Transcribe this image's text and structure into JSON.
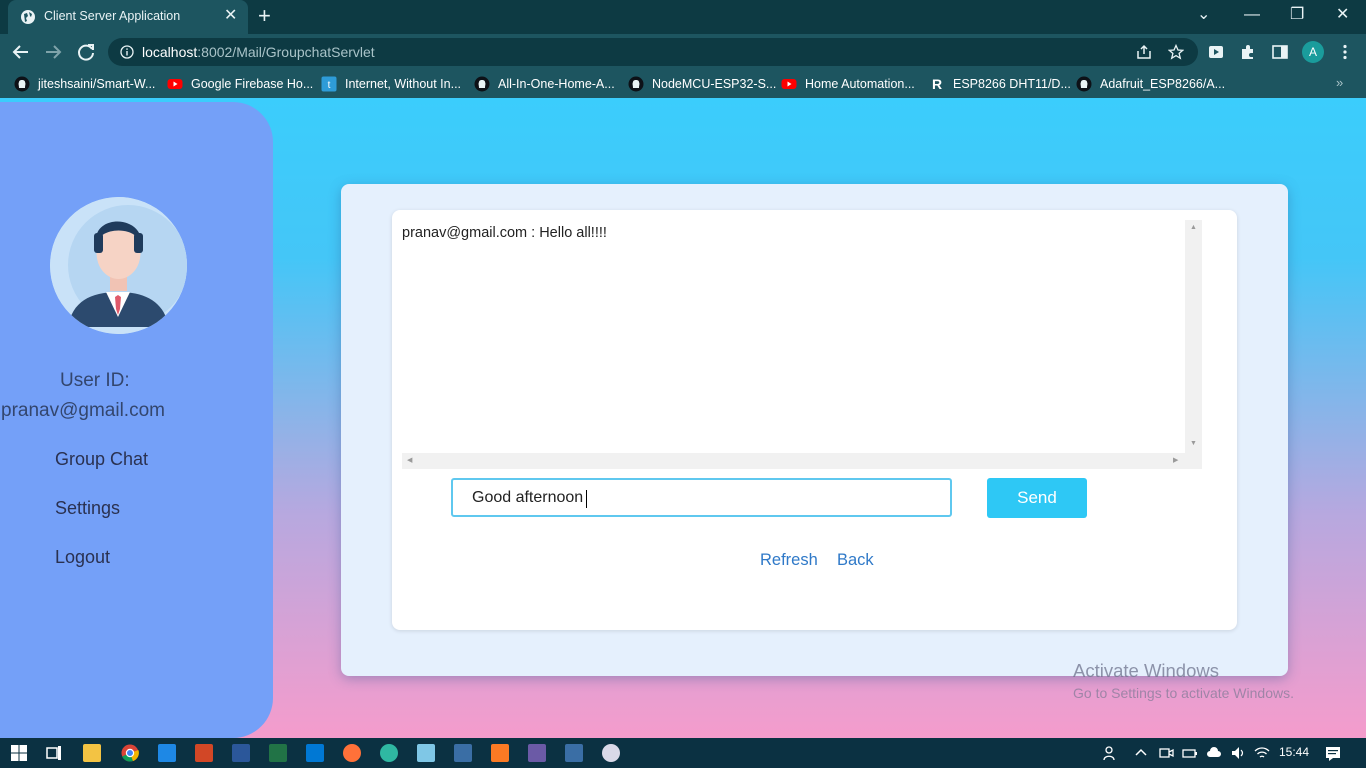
{
  "browser": {
    "tab_title": "Client Server Application",
    "url_host": "localhost",
    "url_path": ":8002/Mail/GroupchatServlet",
    "profile_initial": "A",
    "bookmarks": [
      {
        "label": "jiteshsaini/Smart-W...",
        "icon": "github-icon"
      },
      {
        "label": "Google Firebase Ho...",
        "icon": "youtube-icon"
      },
      {
        "label": "Internet, Without In...",
        "icon": "website-icon"
      },
      {
        "label": "All-In-One-Home-A...",
        "icon": "github-icon"
      },
      {
        "label": "NodeMCU-ESP32-S...",
        "icon": "github-icon"
      },
      {
        "label": "Home Automation...",
        "icon": "youtube-icon"
      },
      {
        "label": "ESP8266 DHT11/D...",
        "icon": "r-icon"
      },
      {
        "label": "Adafruit_ESP8266/A...",
        "icon": "github-icon"
      }
    ],
    "bookmark_more": "»"
  },
  "sidebar": {
    "user_id_label": "User ID:",
    "user_id_value": "pranav@gmail.com",
    "links": {
      "group_chat": "Group Chat",
      "settings": "Settings",
      "logout": "Logout"
    }
  },
  "chat": {
    "messages": "pranav@gmail.com : Hello all!!!!",
    "input_value": "Good afternoon",
    "send_label": "Send",
    "refresh_label": "Refresh",
    "back_label": "Back"
  },
  "watermark": {
    "title": "Activate Windows",
    "subtitle": "Go to Settings to activate Windows."
  },
  "taskbar": {
    "time": "15:44"
  },
  "colors": {
    "accent": "#2ec8f5",
    "sidebar": "#74a0f8",
    "link": "#2f79c8",
    "chrome": "#1d5560"
  }
}
